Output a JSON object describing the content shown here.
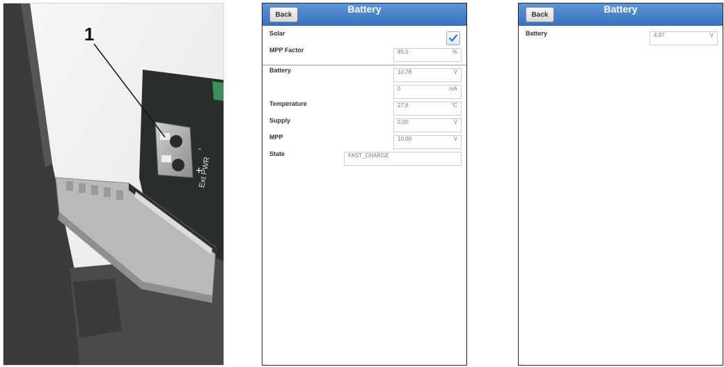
{
  "photo": {
    "callout_number": "1"
  },
  "screen_solar": {
    "back_label": "Back",
    "title": "Battery",
    "rows": {
      "solar": {
        "label": "Solar",
        "checked": true
      },
      "mpp_factor": {
        "label": "MPP Factor",
        "value": "85,0",
        "unit": "%"
      },
      "battery_voltage": {
        "label": "Battery",
        "value": "10,78",
        "unit": "V"
      },
      "battery_current": {
        "label": "",
        "value": "0",
        "unit": "mA"
      },
      "temperature": {
        "label": "Temperature",
        "value": "27,8",
        "unit": "°C"
      },
      "supply": {
        "label": "Supply",
        "value": "0,00",
        "unit": "V"
      },
      "mpp": {
        "label": "MPP",
        "value": "10,00",
        "unit": "V"
      },
      "state": {
        "label": "State",
        "value": "FAST_CHARGE"
      }
    }
  },
  "screen_basic": {
    "back_label": "Back",
    "title": "Battery",
    "rows": {
      "battery_voltage": {
        "label": "Battery",
        "value": "4,97",
        "unit": "V"
      }
    }
  },
  "colors": {
    "header": "#4a84cc",
    "checkmark": "#2e74c8"
  }
}
